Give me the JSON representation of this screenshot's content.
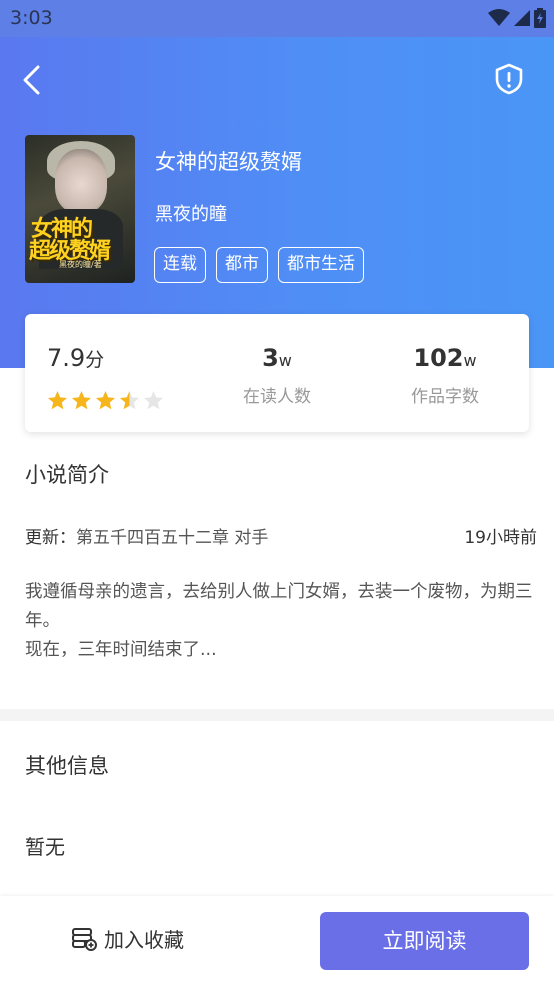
{
  "status_bar": {
    "time": "3:03"
  },
  "book": {
    "title": "女神的超级赘婿",
    "author": "黑夜的瞳",
    "cover_title_line1": "女神的",
    "cover_title_line2": "超级赘婿",
    "cover_author": "黑夜的瞳/著",
    "tags": [
      "连载",
      "都市",
      "都市生活"
    ]
  },
  "stats": {
    "score": "7.9",
    "score_unit": "分",
    "rating_stars": 3.5,
    "rating_max": 5,
    "readers_value": "3",
    "readers_unit": "w",
    "readers_label": "在读人数",
    "words_value": "102",
    "words_unit": "w",
    "words_label": "作品字数"
  },
  "intro": {
    "heading": "小说简介",
    "update_prefix": "更新：",
    "latest_chapter": "第五千四百五十二章 对手",
    "update_time": "19小時前",
    "description_line1": "我遵循母亲的遗言，去给别人做上门女婿，去装一个废物，为期三年。",
    "description_line2": "现在，三年时间结束了..."
  },
  "other_info": {
    "heading": "其他信息",
    "content": "暂无"
  },
  "actions": {
    "favorite_label": "加入收藏",
    "read_label": "立即阅读"
  },
  "colors": {
    "hero_gradient_start": "#5a78f0",
    "hero_gradient_end": "#4a96f6",
    "star_filled": "#f5b51b",
    "star_empty": "#e6e6e6",
    "read_button": "#6a6fe8"
  },
  "icons": {
    "back": "chevron-left-icon",
    "report": "shield-alert-icon",
    "favorite": "bookshelf-add-icon",
    "wifi": "wifi-icon",
    "signal": "signal-icon",
    "battery": "battery-icon"
  }
}
